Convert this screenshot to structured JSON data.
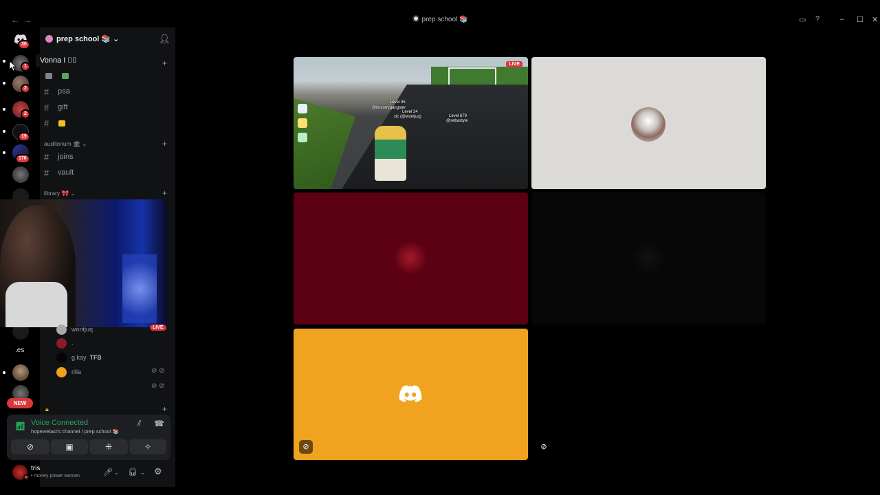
{
  "titlebar": {
    "back": "←",
    "forward": "→",
    "title": "prep school",
    "title_emoji": "📚",
    "inbox": "▭",
    "help": "?",
    "minimize": "–",
    "maximize": "☐",
    "close": "✕"
  },
  "rail": {
    "home_badge": "30",
    "servers": [
      {
        "badge": "1"
      },
      {
        "badge": "2"
      },
      {
        "badge": "2"
      },
      {
        "badge": "19"
      },
      {
        "badge": "170"
      }
    ],
    "es_label": ".es",
    "new_label": "NEW"
  },
  "tooltip": "Vonna I ⌷⌷",
  "guild": {
    "name": "prep school",
    "emoji": "📚",
    "chevron": "⌄"
  },
  "channels": [
    {
      "name": "psa"
    },
    {
      "name": "gift"
    }
  ],
  "categories": {
    "auditorium": "auditorium",
    "auditorium_emoji": "🏛",
    "library": "library",
    "library_emoji": "🎀"
  },
  "auditorium_channels": [
    {
      "name": "joins"
    },
    {
      "name": "vault"
    }
  ],
  "voice_members": [
    {
      "name": "wontjuq"
    },
    {
      "name": "."
    },
    {
      "name": "g.kay",
      "tag": "TFB"
    },
    {
      "name": "rilla"
    }
  ],
  "live_label": "LIVE",
  "voice_panel": {
    "title": "Voice Connected",
    "subtitle": "hopewelast's channel / prep school 📚"
  },
  "user": {
    "name": "tris",
    "status": "• money power women"
  },
  "stage": {
    "live_label": "LIVE",
    "game_texts": {
      "level1": "Level 35",
      "name1": "@imsorrygangster",
      "level2": "Level 34",
      "name2": "clc (@wontjuq)",
      "level3": "Level 679",
      "name3": "@sebastyle"
    }
  },
  "colors": {
    "accent_green": "#23a55a",
    "badge_red": "#da373c",
    "tile_orange": "#f0a31f",
    "tile_red": "#5c0014"
  }
}
